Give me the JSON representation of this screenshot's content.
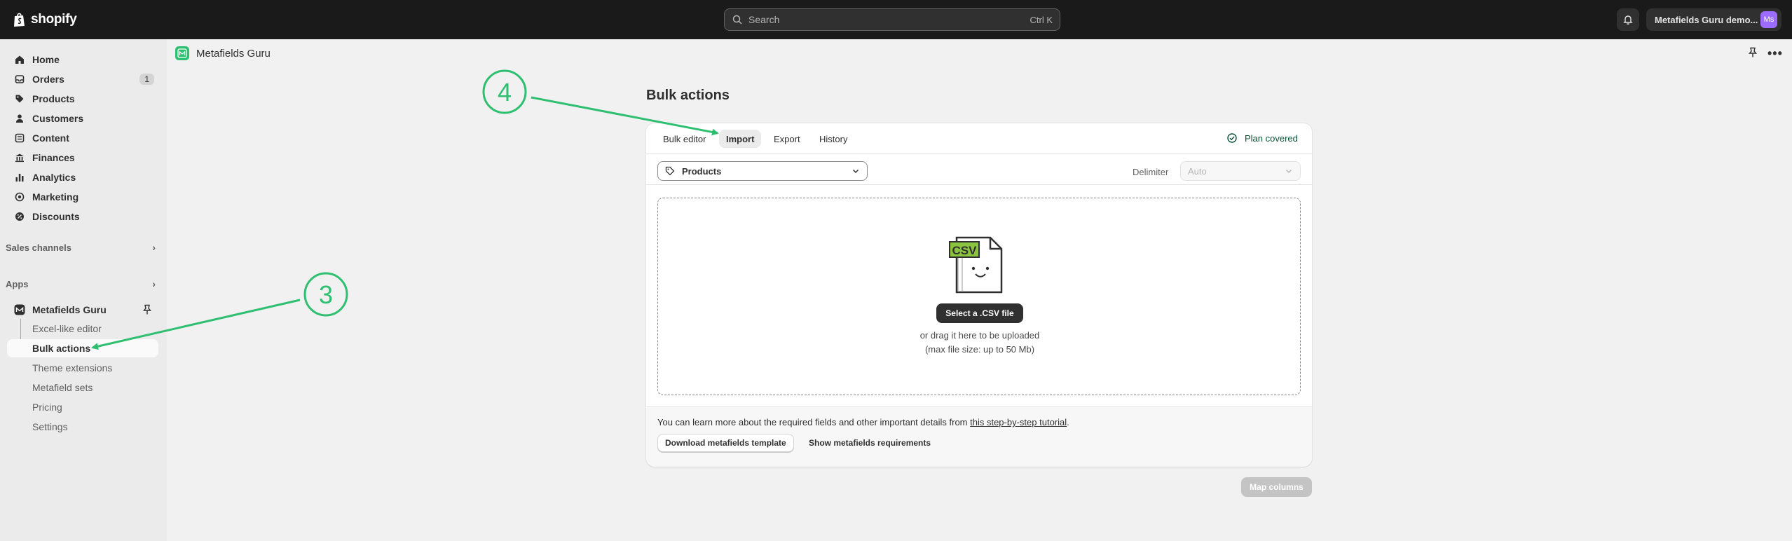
{
  "topbar": {
    "brand": "shopify",
    "search_placeholder": "Search",
    "search_shortcut": "Ctrl K",
    "store_name": "Metafields Guru demo...",
    "store_initials": "Ms"
  },
  "sidebar": {
    "items": [
      {
        "label": "Home",
        "icon": "home-icon"
      },
      {
        "label": "Orders",
        "icon": "orders-icon",
        "badge": "1"
      },
      {
        "label": "Products",
        "icon": "tag-icon"
      },
      {
        "label": "Customers",
        "icon": "person-icon"
      },
      {
        "label": "Content",
        "icon": "content-icon"
      },
      {
        "label": "Finances",
        "icon": "bank-icon"
      },
      {
        "label": "Analytics",
        "icon": "chart-icon"
      },
      {
        "label": "Marketing",
        "icon": "target-icon"
      },
      {
        "label": "Discounts",
        "icon": "discount-icon"
      }
    ],
    "sales_channels": "Sales channels",
    "apps": "Apps",
    "app_name": "Metafields Guru",
    "app_subitems": [
      "Excel-like editor",
      "Bulk actions",
      "Theme extensions",
      "Metafield sets",
      "Pricing",
      "Settings"
    ]
  },
  "appbar": {
    "title": "Metafields Guru"
  },
  "page": {
    "title": "Bulk actions",
    "tabs": [
      "Bulk editor",
      "Import",
      "Export",
      "History"
    ],
    "plan_status": "Plan covered",
    "object_select": "Products",
    "delimiter_label": "Delimiter",
    "delimiter_value": "Auto",
    "select_file_button": "Select a .CSV file",
    "drag_hint": "or drag it here to be uploaded",
    "size_hint": "(max file size: up to 50 Mb)",
    "csv_badge": "CSV",
    "info_text": "You can learn more about the required fields and other important details from ",
    "info_link": "this step-by-step tutorial",
    "info_end": ".",
    "download_template_button": "Download metafields template",
    "show_requirements_button": "Show metafields requirements",
    "map_columns_button": "Map columns"
  },
  "annotations": {
    "step_a": "3",
    "step_b": "4",
    "color": "#2fbf71"
  }
}
